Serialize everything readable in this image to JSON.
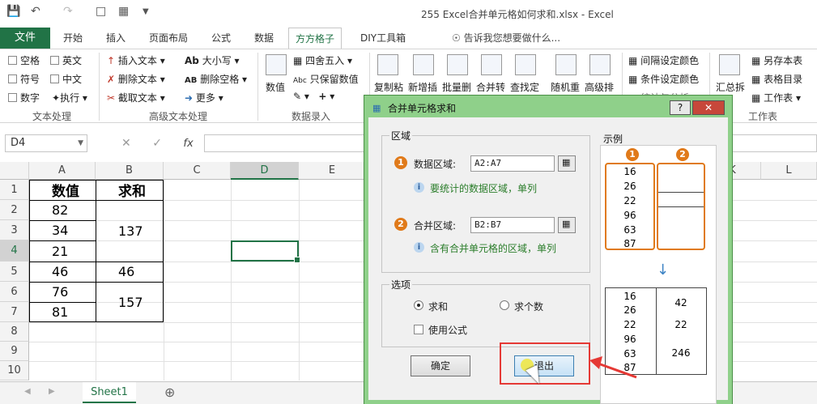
{
  "window": {
    "title": "255 Excel合并单元格如何求和.xlsx - Excel"
  },
  "ribbon_tabs": [
    "文件",
    "开始",
    "插入",
    "页面布局",
    "公式",
    "数据",
    "方方格子",
    "DIY工具箱"
  ],
  "tell_me": "告诉我您想要做什么...",
  "ribbon": {
    "text_group": {
      "items": [
        "空格",
        "英文",
        "符号",
        "中文",
        "数字",
        "执行"
      ],
      "label": "文本处理"
    },
    "adv_group": {
      "items": [
        "插入文本",
        "删除文本",
        "截取文本",
        "大小写",
        "删除空格",
        "更多"
      ],
      "label": "高级文本处理"
    },
    "num_group": {
      "items": [
        "数值",
        "四舍五入",
        "只保留数值"
      ],
      "label": "数据录入"
    },
    "big_buttons": [
      "复制粘",
      "新增插",
      "批量删",
      "合并转",
      "查找定",
      "随机重",
      "高级排"
    ],
    "right_items": [
      "间隔设定颜色",
      "条件设定颜色",
      "统计与分析",
      "汇总拆",
      "另存本表",
      "表格目录",
      "工作表"
    ],
    "right_label": "工作表"
  },
  "formula_bar": {
    "name_box": "D4",
    "fx": "fx"
  },
  "columns": [
    "A",
    "B",
    "C",
    "D",
    "E",
    "K",
    "L"
  ],
  "rows": [
    "1",
    "2",
    "3",
    "4",
    "5",
    "6",
    "7",
    "8",
    "9",
    "10"
  ],
  "table": {
    "header_a": "数值",
    "header_b": "求和",
    "values": [
      "82",
      "34",
      "21",
      "46",
      "76",
      "81"
    ],
    "sums": [
      "137",
      "46",
      "157"
    ]
  },
  "sheet": {
    "tab": "Sheet1",
    "add": "⊕"
  },
  "dialog": {
    "title": "合并单元格求和",
    "region_label": "区域",
    "data_label": "数据区域:",
    "data_value": "A2:A7",
    "data_hint": "要统计的数据区域，单列",
    "merge_label": "合并区域:",
    "merge_value": "B2:B7",
    "merge_hint": "含有合并单元格的区域，单列",
    "options_label": "选项",
    "opt_sum": "求和",
    "opt_count": "求个数",
    "opt_formula": "使用公式",
    "ok": "确定",
    "exit": "退出",
    "example_label": "示例",
    "example_top": [
      "16",
      "26",
      "22",
      "96",
      "63",
      "87"
    ],
    "example_bottom_left": [
      "16",
      "26",
      "22",
      "96",
      "63",
      "87"
    ],
    "example_bottom_right": [
      "42",
      "22",
      "246"
    ],
    "badge1": "1",
    "badge2": "2"
  },
  "colors": {
    "excel_green": "#217346",
    "dialog_green": "#8fd08a",
    "orange": "#e07a1a",
    "red_arrow": "#e53935"
  }
}
